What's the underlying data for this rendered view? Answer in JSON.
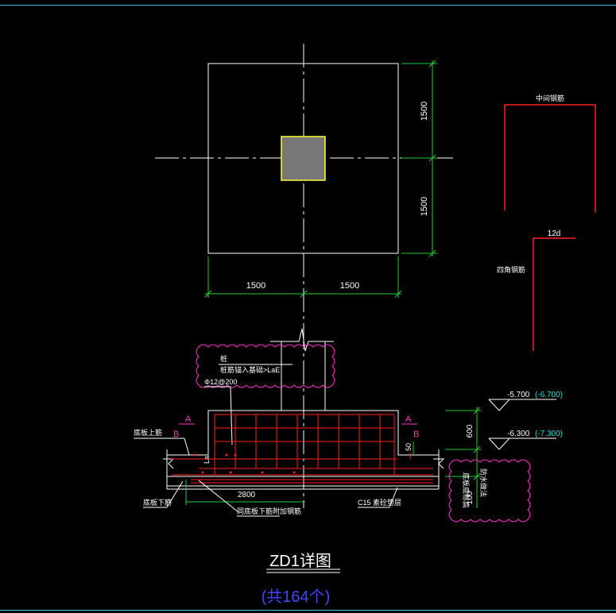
{
  "plan": {
    "dim_right_top": "1500",
    "dim_right_bottom": "1500",
    "dim_bottom_left": "1500",
    "dim_bottom_right": "1500"
  },
  "side_details": {
    "middle_rebar_label": "中间钢筋",
    "corner_rebar_label": "四角钢筋",
    "hook_dim": "12d"
  },
  "section": {
    "column_note_title": "桩",
    "column_note_text": "桩筋锚入基础>LaE",
    "rebar_spec": "Φ12@200",
    "section_mark_left": "A",
    "section_mark_left_b": "B",
    "section_mark_right": "A",
    "section_mark_right_b": "B",
    "slab_top_label": "底板上筋",
    "slab_bottom_label": "底板下筋",
    "lap_label": "La",
    "width_dim": "2800",
    "bottom_rebar_note": "同底板下筋附加钢筋",
    "cushion_label": "C15 素砼垫层",
    "dim_50": "50",
    "dim_600": "600",
    "dim_100": "100",
    "elev_top": "-5.700",
    "elev_top_alt": "(-6.700)",
    "elev_mid": "-6.300",
    "elev_mid_alt": "(-7.300)",
    "right_note_1": "底板底标高",
    "right_note_2": "防水做法"
  },
  "title": {
    "main": "ZD1详图",
    "count": "(共164个)"
  },
  "colors": {
    "background": "#000000",
    "line_white": "#ffffff",
    "dim_green": "#22cc33",
    "rebar_red": "#ff2020",
    "cloud_magenta": "#ff33cc",
    "column_fill": "#777777",
    "column_outline": "#ffff33",
    "title_blue": "#4444ff",
    "elev_cyan": "#33dddd",
    "frame_cyan": "#3cc7d6"
  }
}
